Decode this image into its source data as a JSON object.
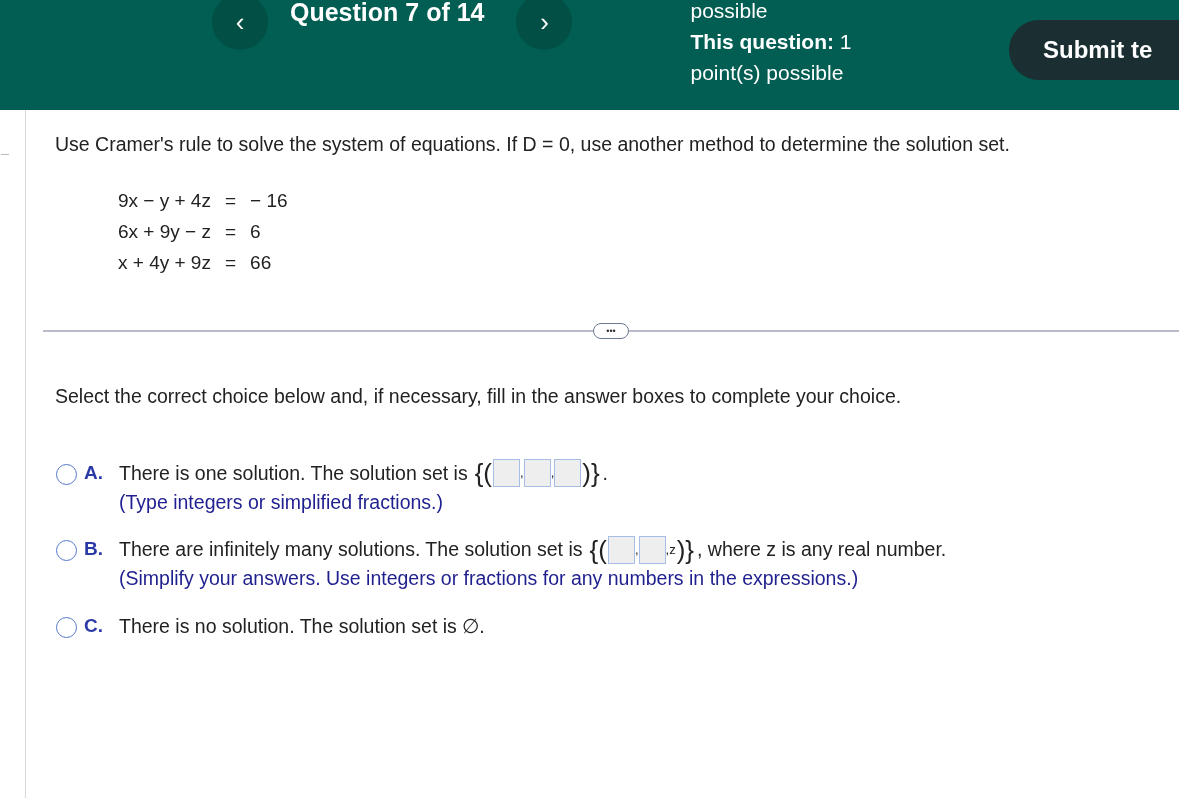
{
  "header": {
    "prev_label": "‹",
    "title": "Question 7 of 14",
    "next_label": "›",
    "points_cut": "possible",
    "points_label": "This question:",
    "points_value": "1",
    "points_suffix": "point(s) possible",
    "submit": "Submit te"
  },
  "question": {
    "prompt": "Use Cramer's rule to solve the system of equations. If D = 0, use another method to determine the solution set.",
    "equations": [
      {
        "lhs": "9x − y + 4z",
        "eq": "=",
        "rhs": "− 16"
      },
      {
        "lhs": "6x + 9y − z",
        "eq": "=",
        "rhs": "6"
      },
      {
        "lhs": "x + 4y + 9z",
        "eq": "=",
        "rhs": "66"
      }
    ],
    "more_button": "•••"
  },
  "instruction": "Select the correct choice below and, if necessary, fill in the answer boxes to complete your choice.",
  "choices": [
    {
      "letter": "A.",
      "selected": false,
      "parts": [
        {
          "kind": "text",
          "text": "There is one solution. The solution set is"
        },
        {
          "kind": "brace",
          "text": "{("
        },
        {
          "kind": "box"
        },
        {
          "kind": "comma",
          "text": ","
        },
        {
          "kind": "box"
        },
        {
          "kind": "comma",
          "text": ","
        },
        {
          "kind": "box"
        },
        {
          "kind": "brace",
          "text": ")}"
        },
        {
          "kind": "text",
          "text": "."
        }
      ],
      "hint": "(Type integers or simplified fractions.)"
    },
    {
      "letter": "B.",
      "selected": false,
      "parts": [
        {
          "kind": "text",
          "text": "There are infinitely many solutions. The solution set is"
        },
        {
          "kind": "brace",
          "text": "{("
        },
        {
          "kind": "box"
        },
        {
          "kind": "comma",
          "text": ","
        },
        {
          "kind": "box"
        },
        {
          "kind": "comma",
          "text": ",z"
        },
        {
          "kind": "brace",
          "text": ")}"
        },
        {
          "kind": "text",
          "text": ", where z is any real number."
        }
      ],
      "hint": "(Simplify your answers. Use integers or fractions for any numbers in the expressions.)"
    },
    {
      "letter": "C.",
      "selected": false,
      "parts": [
        {
          "kind": "text",
          "text": "There is no solution. The solution set is ∅."
        }
      ]
    }
  ]
}
